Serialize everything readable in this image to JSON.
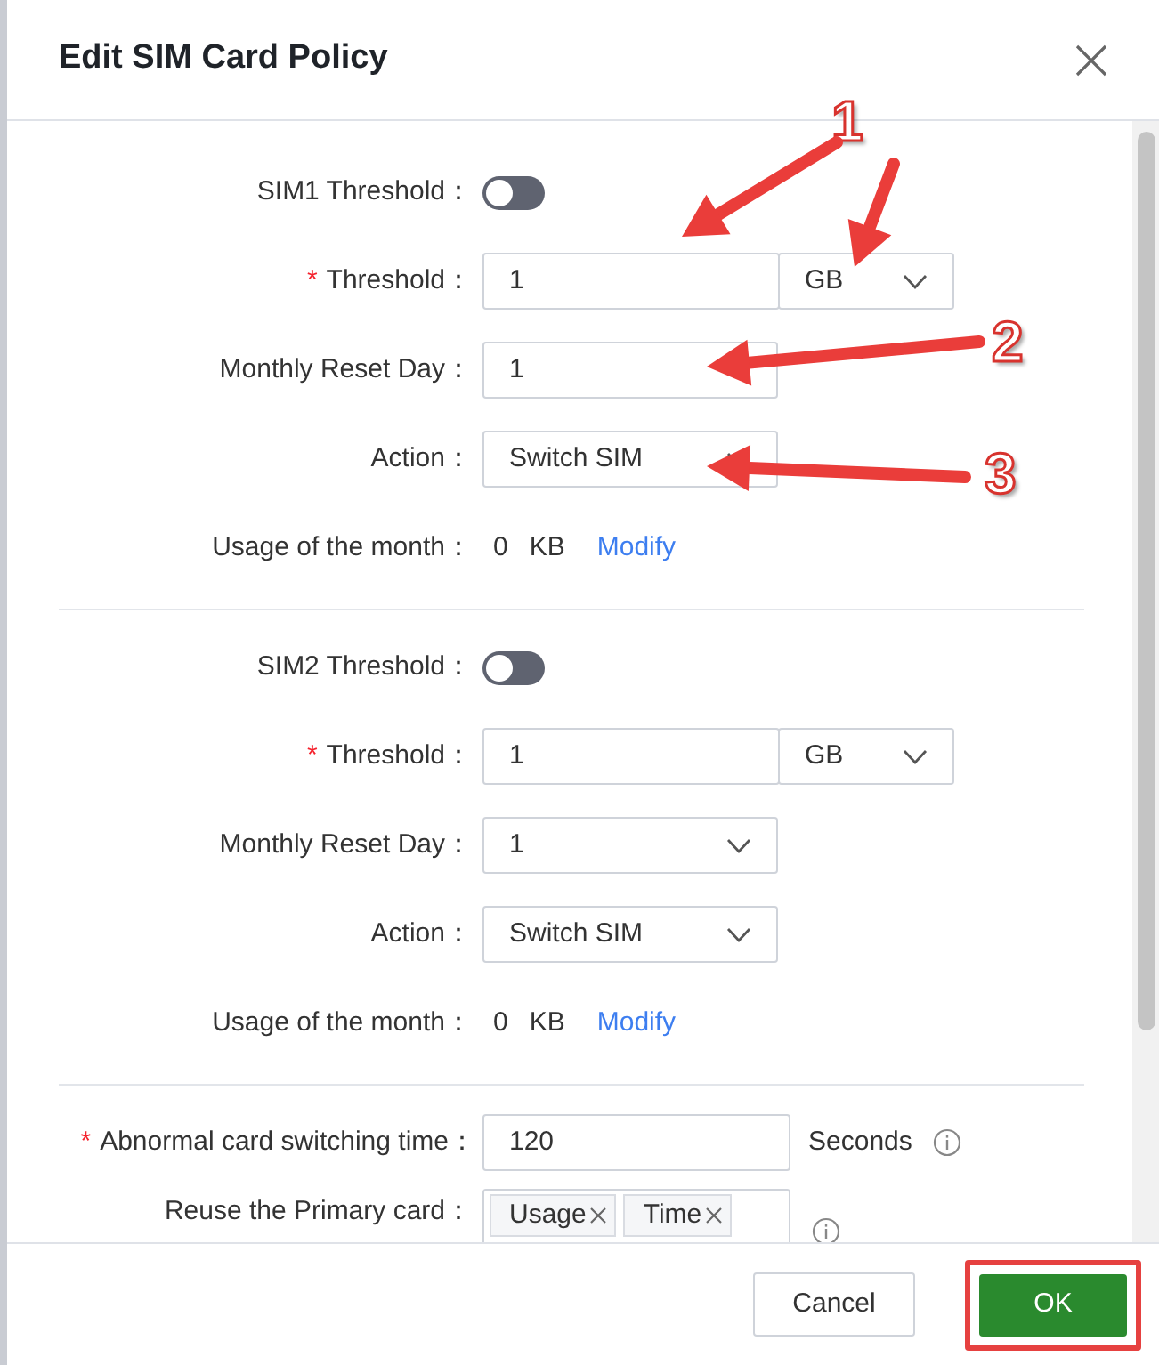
{
  "dialog": {
    "title": "Edit SIM Card Policy"
  },
  "sections": [
    {
      "toggle": {
        "label": "SIM1 Threshold：",
        "on": false
      },
      "threshold": {
        "label": "Threshold：",
        "required_mark": "*",
        "value": "1",
        "unit": "GB"
      },
      "reset_day": {
        "label": "Monthly Reset Day：",
        "value": "1"
      },
      "action": {
        "label": "Action：",
        "value": "Switch SIM"
      },
      "usage": {
        "label": "Usage of the month：",
        "value": "0",
        "unit": "KB",
        "link": "Modify"
      }
    },
    {
      "toggle": {
        "label": "SIM2 Threshold：",
        "on": false
      },
      "threshold": {
        "label": "Threshold：",
        "required_mark": "*",
        "value": "1",
        "unit": "GB"
      },
      "reset_day": {
        "label": "Monthly Reset Day：",
        "value": "1"
      },
      "action": {
        "label": "Action：",
        "value": "Switch SIM"
      },
      "usage": {
        "label": "Usage of the month：",
        "value": "0",
        "unit": "KB",
        "link": "Modify"
      }
    }
  ],
  "abnormal": {
    "label": "Abnormal card switching time：",
    "required_mark": "*",
    "value": "120",
    "suffix": "Seconds"
  },
  "reuse": {
    "label": "Reuse the Primary card：",
    "tags": [
      "Usage",
      "Time"
    ]
  },
  "buttons": [
    {
      "label": "Cancel",
      "kind": "secondary",
      "highlighted": false
    },
    {
      "label": "OK",
      "kind": "primary",
      "highlighted": true
    }
  ],
  "annotations": [
    {
      "number": "1"
    },
    {
      "number": "2"
    },
    {
      "number": "3"
    }
  ]
}
